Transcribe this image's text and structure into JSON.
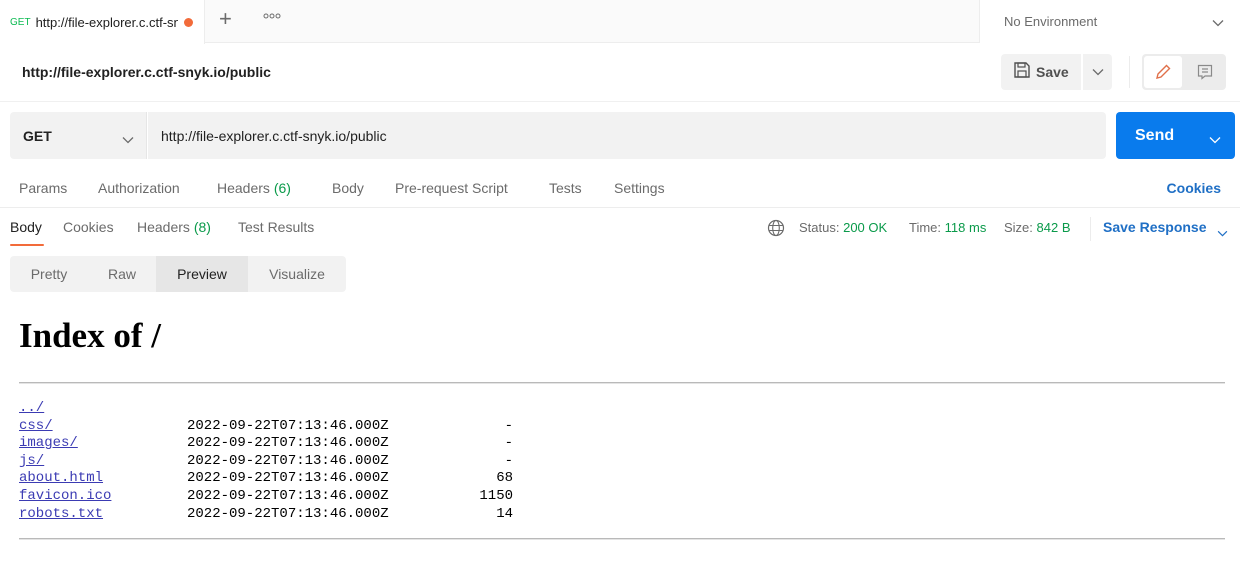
{
  "tabbar": {
    "active_tab": {
      "method": "GET",
      "title": "http://file-explorer.c.ctf-snyk.io/public",
      "unsaved_indicator_color": "#f26b3a"
    },
    "new_tab_icon": "plus-icon",
    "more_icon": "more-horizontal-icon",
    "environment": {
      "label": "No Environment"
    }
  },
  "request": {
    "title": "http://file-explorer.c.ctf-snyk.io/public",
    "save_label": "Save",
    "method": "GET",
    "url": "http://file-explorer.c.ctf-snyk.io/public",
    "send_label": "Send",
    "tabs": [
      {
        "label": "Params"
      },
      {
        "label": "Authorization"
      },
      {
        "label": "Headers",
        "count": "(6)"
      },
      {
        "label": "Body"
      },
      {
        "label": "Pre-request Script"
      },
      {
        "label": "Tests"
      },
      {
        "label": "Settings"
      }
    ],
    "cookies_label": "Cookies"
  },
  "response": {
    "tabs": [
      {
        "label": "Body",
        "active": true
      },
      {
        "label": "Cookies"
      },
      {
        "label": "Headers",
        "count": "(8)"
      },
      {
        "label": "Test Results"
      }
    ],
    "status_label": "Status:",
    "status_value": "200 OK",
    "time_label": "Time:",
    "time_value": "118 ms",
    "size_label": "Size:",
    "size_value": "842 B",
    "save_response_label": "Save Response",
    "view_modes": [
      {
        "label": "Pretty"
      },
      {
        "label": "Raw"
      },
      {
        "label": "Preview",
        "active": true
      },
      {
        "label": "Visualize"
      }
    ]
  },
  "preview": {
    "title": "Index of /",
    "entries": [
      {
        "name": "../",
        "date": "",
        "size": ""
      },
      {
        "name": "css/",
        "date": "2022-09-22T07:13:46.000Z",
        "size": "-"
      },
      {
        "name": "images/",
        "date": "2022-09-22T07:13:46.000Z",
        "size": "-"
      },
      {
        "name": "js/",
        "date": "2022-09-22T07:13:46.000Z",
        "size": "-"
      },
      {
        "name": "about.html",
        "date": "2022-09-22T07:13:46.000Z",
        "size": "68"
      },
      {
        "name": "favicon.ico",
        "date": "2022-09-22T07:13:46.000Z",
        "size": "1150"
      },
      {
        "name": "robots.txt",
        "date": "2022-09-22T07:13:46.000Z",
        "size": "14"
      }
    ]
  },
  "colors": {
    "accent_orange": "#f26b3a",
    "send_blue": "#097bed",
    "link_blue": "#1f6fc5",
    "success_green": "#0a9a4a"
  }
}
